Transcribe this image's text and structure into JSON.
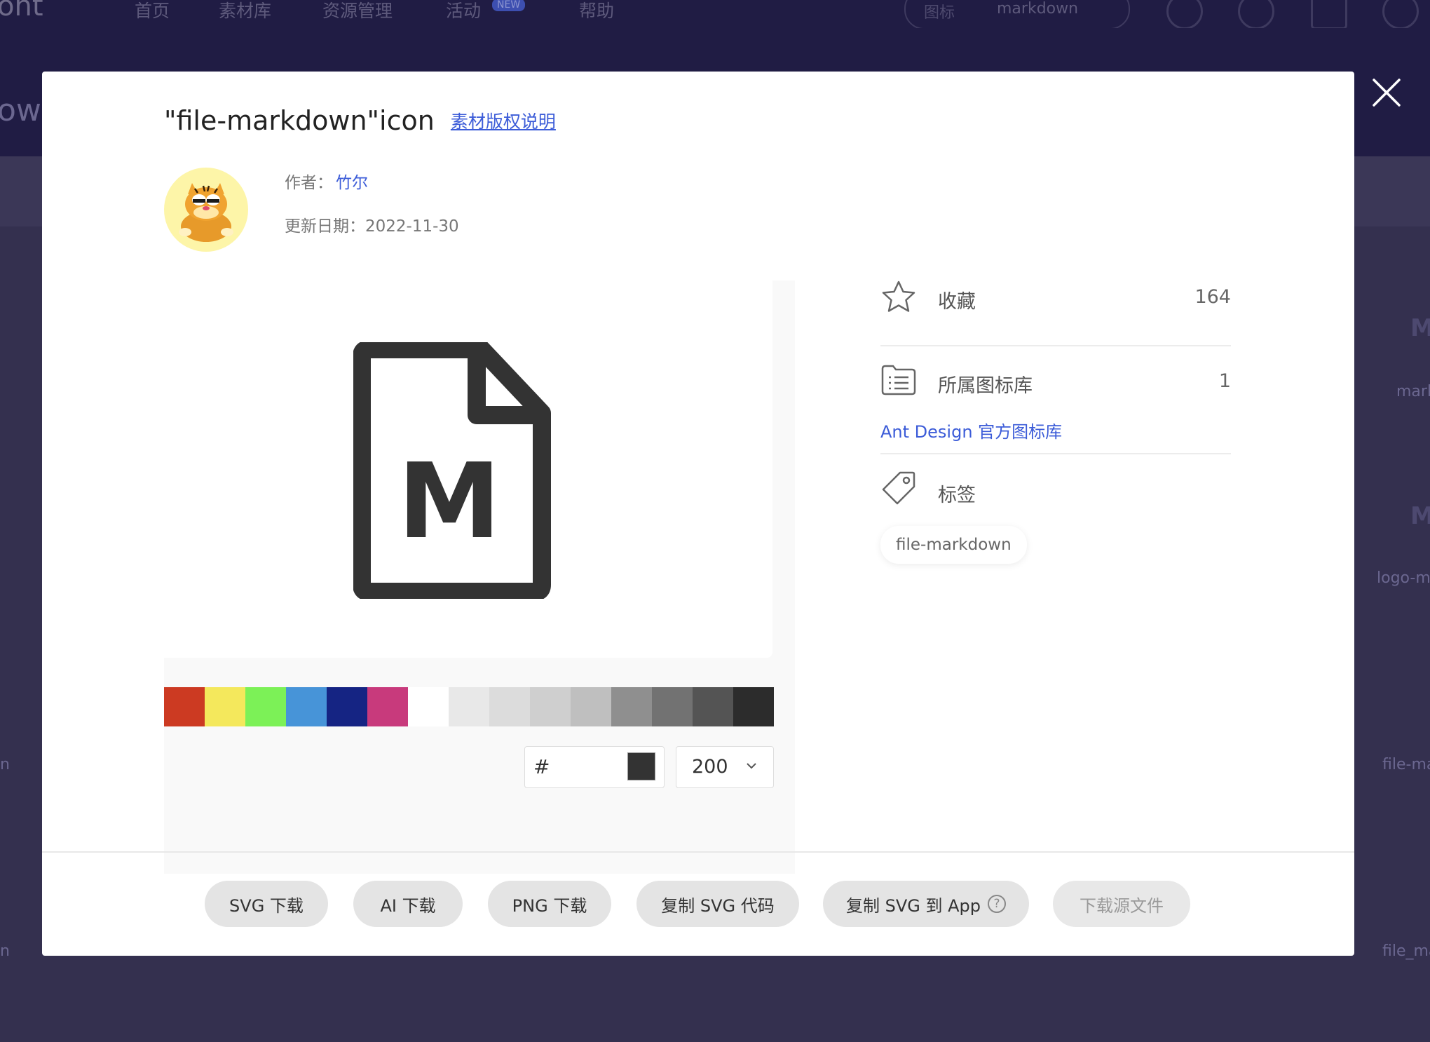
{
  "background": {
    "logo": "ont",
    "nav": [
      "首页",
      "素材库",
      "资源管理",
      "活动",
      "帮助"
    ],
    "nav_badge": "NEW",
    "search": {
      "type": "图标",
      "query": "markdown"
    },
    "hero_fragment": "owr",
    "right_labels": [
      "mark",
      "logo-m",
      "file-ma",
      "file_ma"
    ],
    "left_labels": [
      "n",
      "n"
    ]
  },
  "modal": {
    "title": "\"file-markdown\"icon",
    "copyright_link": "素材版权说明",
    "author_label": "作者：",
    "author_name": "竹尔",
    "update_label": "更新日期：",
    "update_date": "2022-11-30",
    "preview": {
      "icon_name": "file-markdown-icon",
      "glyph": "M",
      "swatches": [
        "#cc3a22",
        "#f4e85c",
        "#7cf157",
        "#4794d8",
        "#152483",
        "#c83a7c",
        "#ffffff",
        "#e8e8e8",
        "#dcdcdc",
        "#cfcfcf",
        "#bfbfbf",
        "#8f8f8f",
        "#727272",
        "#545454",
        "#2c2c2c"
      ],
      "color_prefix": "#",
      "color_value": "",
      "current_color": "#333333",
      "size_value": "200"
    },
    "side": {
      "favorite_label": "收藏",
      "favorite_count": "164",
      "library_label": "所属图标库",
      "library_count": "1",
      "library_link": "Ant Design 官方图标库",
      "tags_label": "标签",
      "tags": [
        "file-markdown"
      ]
    },
    "buttons": {
      "svg_download": "SVG 下载",
      "ai_download": "AI 下载",
      "png_download": "PNG 下载",
      "copy_svg_code": "复制 SVG 代码",
      "copy_svg_to_app": "复制 SVG 到 App",
      "download_source": "下载源文件"
    }
  }
}
